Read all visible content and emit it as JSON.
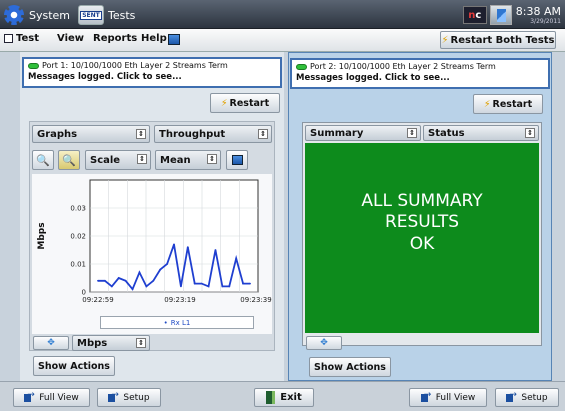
{
  "topbar": {
    "system_label": "System",
    "tests_label": "Tests",
    "tests_icon_text": "SENT",
    "logo_text_n": "n",
    "logo_text_c": "c",
    "time": "8:38 AM",
    "date": "3/29/2011"
  },
  "menubar": {
    "test": "Test",
    "view": "View",
    "reports": "Reports",
    "help": "Help",
    "restart_both": "Restart Both Tests"
  },
  "port1": {
    "title": "Port 1: 10/100/1000 Eth Layer 2 Streams Term",
    "message": "Messages logged. Click to see...",
    "restart": "Restart",
    "view_select": "Graphs",
    "metric_select": "Throughput",
    "scale_select": "Scale",
    "mode_select": "Mean",
    "units_select": "Mbps",
    "show_actions": "Show Actions"
  },
  "port2": {
    "title": "Port 2: 10/100/1000 Eth Layer 2 Streams Term",
    "message": "Messages logged. Click to see...",
    "restart": "Restart",
    "col_summary": "Summary",
    "col_status": "Status",
    "summary_line1": "ALL SUMMARY",
    "summary_line2": "RESULTS",
    "summary_line3": "OK",
    "show_actions": "Show Actions"
  },
  "bottombar": {
    "full_view_1": "Full View",
    "setup_1": "Setup",
    "exit": "Exit",
    "full_view_2": "Full View",
    "setup_2": "Setup"
  },
  "chart_data": {
    "type": "line",
    "ylabel": "Mbps",
    "ylim": [
      0,
      0.04
    ],
    "yticks": [
      "0",
      "0.01",
      "0.02",
      "0.03"
    ],
    "xticks": [
      "09:22:59",
      "09:23:19",
      "09:23:39"
    ],
    "series": [
      {
        "name": "Rx L1",
        "color": "#1f3fd0",
        "values": [
          0.004,
          0.004,
          0.002,
          0.005,
          0.004,
          0.001,
          0.007,
          0.002,
          0.004,
          0.008,
          0.01,
          0.017,
          0.002,
          0.016,
          0.003,
          0.003,
          0.002,
          0.015,
          0.002,
          0.002,
          0.012,
          0.003,
          0.003
        ]
      }
    ],
    "grid": true
  }
}
